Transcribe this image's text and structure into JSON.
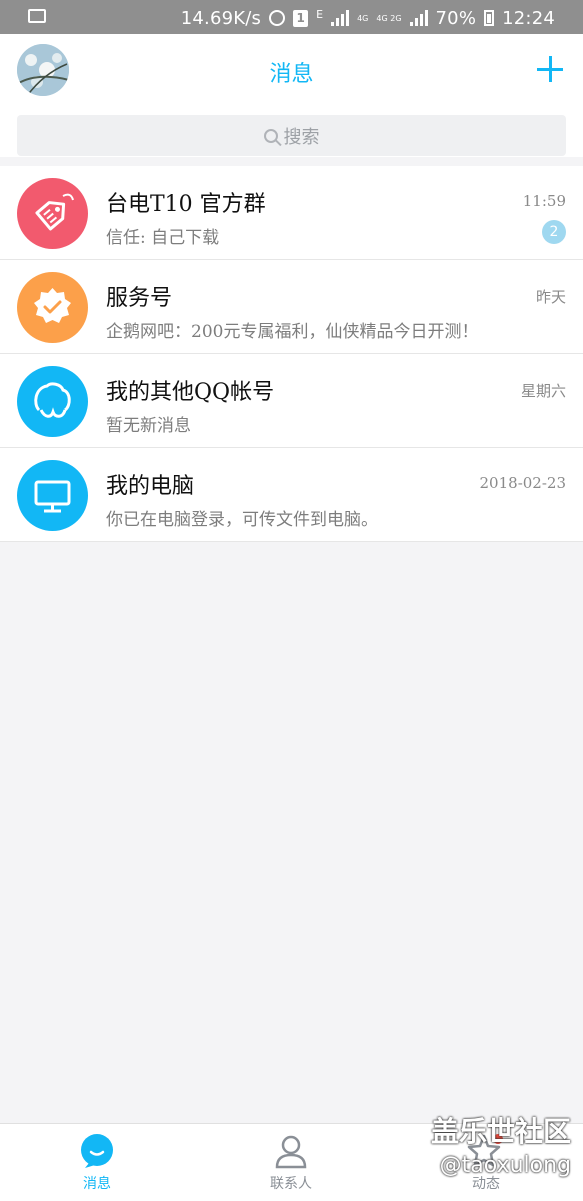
{
  "status_bar": {
    "speed": "14.69K/s",
    "notif_count": "1",
    "net_e": "E",
    "net_4g_a": "4G",
    "net_4g_b": "4G 2G",
    "battery": "70%",
    "time": "12:24"
  },
  "header": {
    "title": "消息",
    "search_placeholder": "搜索"
  },
  "conversations": [
    {
      "name": "台电T10 官方群",
      "time": "11:59",
      "message": "信任: 自己下载",
      "badge": "2",
      "icon": "tag-icon",
      "color": "#f25a6e"
    },
    {
      "name": "服务号",
      "time": "昨天",
      "message": "企鹅网吧：200元专属福利，仙侠精品今日开测！",
      "badge": "",
      "icon": "verified-badge-icon",
      "color": "#fca04a"
    },
    {
      "name": "我的其他QQ帐号",
      "time": "星期六",
      "message": "暂无新消息",
      "badge": "",
      "icon": "linked-accounts-icon",
      "color": "#12b7f5"
    },
    {
      "name": "我的电脑",
      "time": "2018-02-23",
      "message": "你已在电脑登录，可传文件到电脑。",
      "badge": "",
      "icon": "monitor-icon",
      "color": "#12b7f5"
    }
  ],
  "tabs": [
    {
      "label": "消息",
      "icon": "message-bubble-icon",
      "active": true
    },
    {
      "label": "联系人",
      "icon": "contact-person-icon",
      "active": false
    },
    {
      "label": "动态",
      "icon": "star-icon",
      "active": false
    }
  ],
  "watermark": {
    "line1": "盖乐世社区",
    "line2": "@taoxulong"
  },
  "colors": {
    "accent": "#12b7f5",
    "status_bar": "#8f8f8f",
    "background": "#f4f4f6"
  }
}
